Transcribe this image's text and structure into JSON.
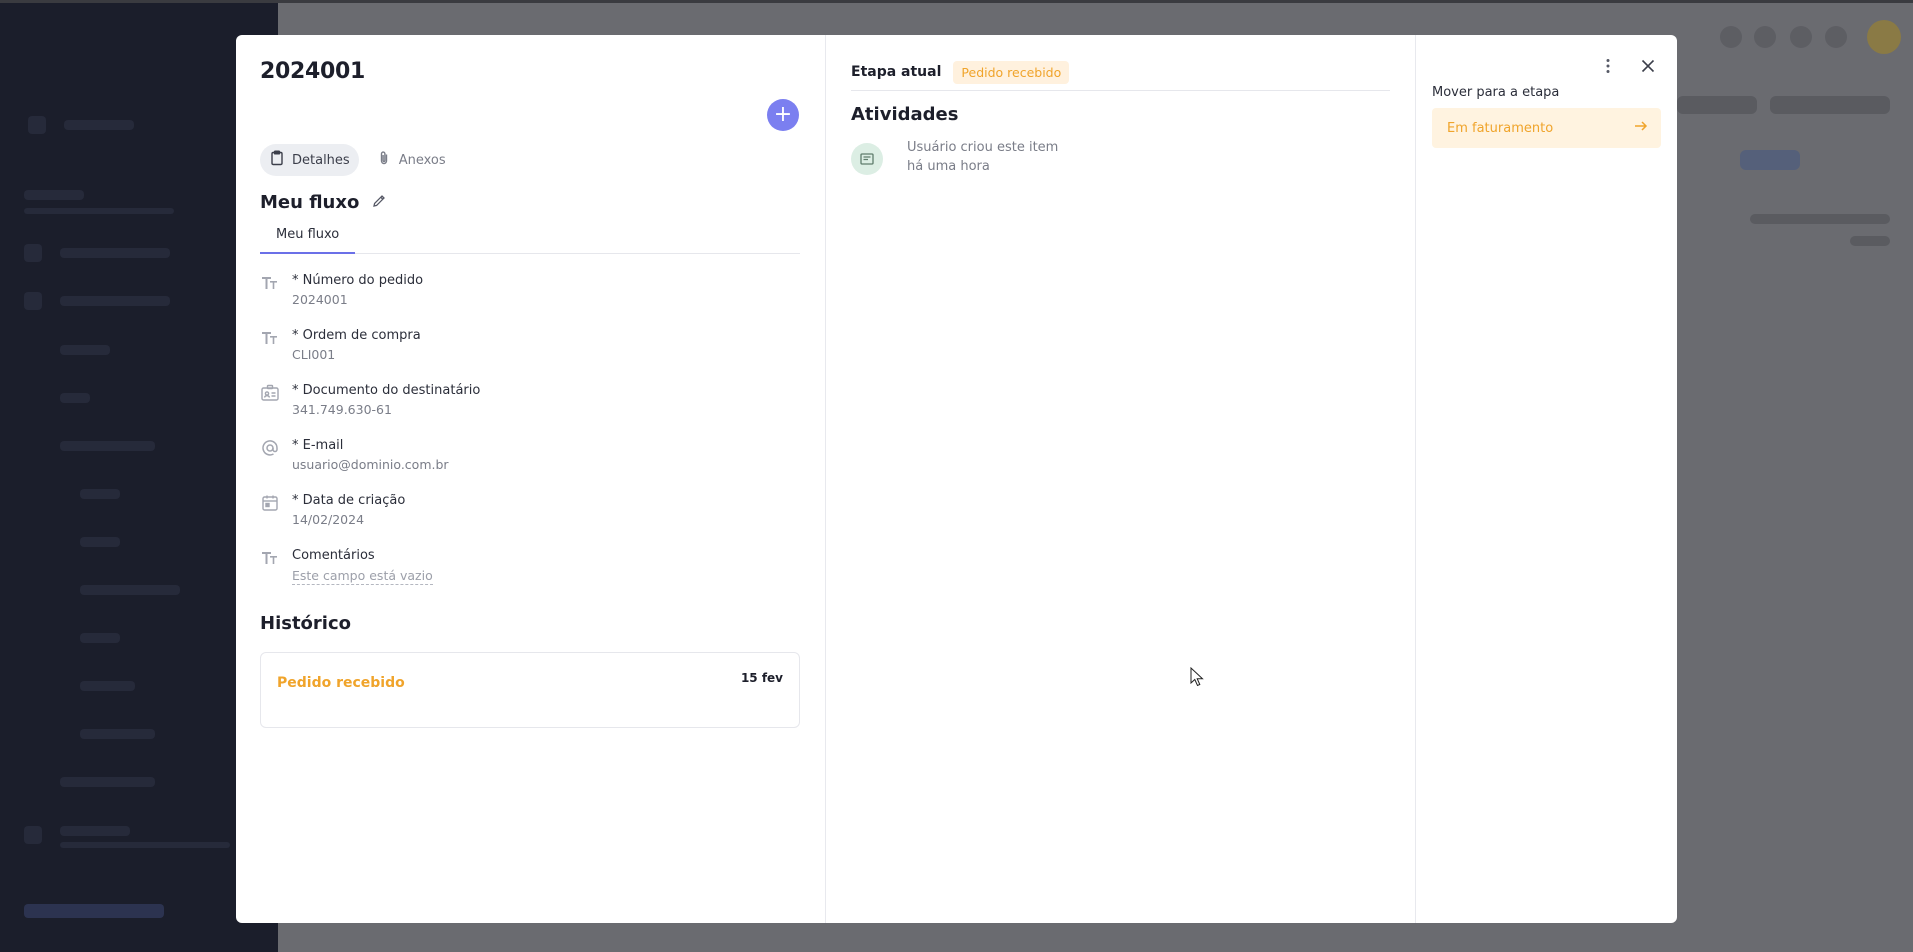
{
  "item": {
    "title": "2024001",
    "add_label": "+"
  },
  "top_tabs": [
    {
      "label": "Detalhes",
      "icon": "clipboard-icon",
      "active": true
    },
    {
      "label": "Anexos",
      "icon": "paperclip-icon",
      "active": false
    }
  ],
  "flow": {
    "title": "Meu fluxo",
    "tab_label": "Meu fluxo"
  },
  "fields": [
    {
      "label": "* Número do pedido",
      "value": "2024001",
      "icon": "text-type-icon"
    },
    {
      "label": "* Ordem de compra",
      "value": "CLI001",
      "icon": "text-type-icon"
    },
    {
      "label": "* Documento do destinatário",
      "value": "341.749.630-61",
      "icon": "id-card-icon"
    },
    {
      "label": "* E-mail",
      "value": "usuario@dominio.com.br",
      "icon": "at-sign-icon"
    },
    {
      "label": "* Data de criação",
      "value": "14/02/2024",
      "icon": "calendar-icon"
    },
    {
      "label": "Comentários",
      "value": "Este campo está vazio",
      "icon": "text-type-icon"
    }
  ],
  "history": {
    "title": "Histórico",
    "entries": [
      {
        "name": "Pedido recebido",
        "date": "15 fev"
      }
    ]
  },
  "stage": {
    "label": "Etapa atual",
    "badge": "Pedido recebido"
  },
  "activities": {
    "title": "Atividades",
    "items": [
      {
        "text": "Usuário criou este item",
        "time": "há uma hora",
        "icon": "message-icon"
      }
    ]
  },
  "move": {
    "label": "Mover para a etapa",
    "target": "Em faturamento"
  },
  "colors": {
    "accent": "#7b7ff0",
    "stage": "#f0a42b",
    "stage_bg": "#fff1de"
  }
}
